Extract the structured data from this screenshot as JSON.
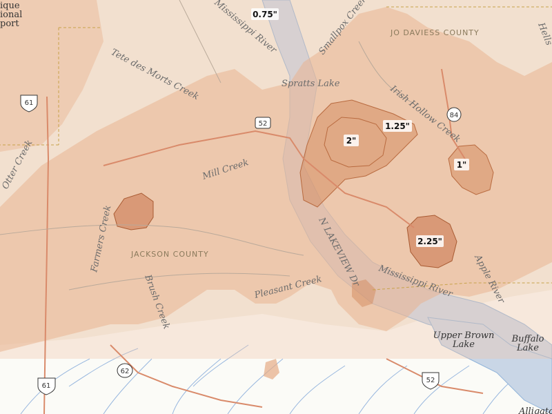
{
  "map": {
    "colors": {
      "land": "#f3eee4",
      "water": "#c9d6e6",
      "river_line": "#8fb3d9",
      "road": "#d98a6a",
      "snow_light": "#f0c9b0",
      "snow_mid": "#e0a47e",
      "snow_dark": "#c8734a",
      "county_border": "#c8a24a"
    },
    "place_labels": {
      "mississippi_river_upper": "Mississippi River",
      "mississippi_river_lower": "Mississippi River",
      "smallpox_creek": "Smallpox Creek",
      "tete_des_morts_creek": "Tete des Morts Creek",
      "spratts_lake": "Spratts Lake",
      "irish_hollow_creek": "Irish Hollow Creek",
      "mill_creek": "Mill Creek",
      "farmers_creek": "Farmers Creek",
      "otter_creek": "Otter Creek",
      "brush_creek": "Brush Creek",
      "pleasant_creek": "Pleasant Creek",
      "lakeview_dr": "N LAKEVIEW Dr",
      "apple_river": "Apple River",
      "upper_brown_lake_1": "Upper Brown",
      "upper_brown_lake_2": "Lake",
      "buffalo_lake_1": "Buffalo",
      "buffalo_lake_2": "Lake",
      "alligator": "Alligato",
      "regional_airport": "ique\nional\nport",
      "hells": "Hells",
      "airport_line1": "ique",
      "airport_line2": "ional",
      "airport_line3": "port"
    },
    "county_labels": {
      "jo_daviess": "JO DAVIESS COUNTY",
      "jackson": "JACKSON COUNTY"
    },
    "route_shields": {
      "r61_top": "61",
      "r52_mid": "52",
      "r84": "84",
      "r62": "62",
      "r61_bottom": "61",
      "r52_bottom": "52"
    },
    "snowfall_labels": {
      "l075": "0.75\"",
      "l125": "1.25\"",
      "l2": "2\"",
      "l1": "1\"",
      "l225": "2.25\""
    }
  }
}
